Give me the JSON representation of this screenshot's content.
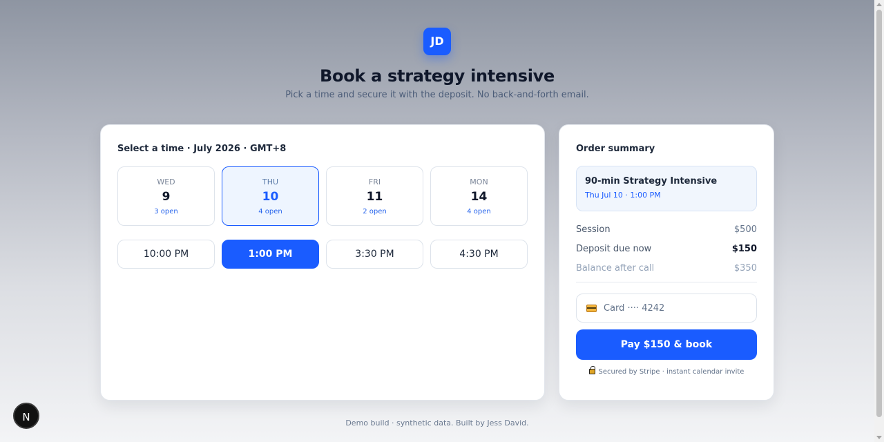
{
  "header": {
    "avatar_initials": "JD",
    "title": "Book a strategy intensive",
    "subtitle": "Pick a time and secure it with the deposit. No back-and-forth email."
  },
  "scheduler": {
    "title": "Select a time · July 2026 · GMT+8",
    "days": [
      {
        "dow": "WED",
        "num": "9",
        "open": "3 open",
        "selected": false
      },
      {
        "dow": "THU",
        "num": "10",
        "open": "4 open",
        "selected": true
      },
      {
        "dow": "FRI",
        "num": "11",
        "open": "2 open",
        "selected": false
      },
      {
        "dow": "MON",
        "num": "14",
        "open": "4 open",
        "selected": false
      }
    ],
    "slots": [
      {
        "label": "10:00 PM",
        "selected": false
      },
      {
        "label": "1:00 PM",
        "selected": true
      },
      {
        "label": "3:30 PM",
        "selected": false
      },
      {
        "label": "4:30 PM",
        "selected": false
      }
    ]
  },
  "summary": {
    "title": "Order summary",
    "service_name": "90-min Strategy Intensive",
    "service_when": "Thu Jul 10 · 1:00 PM",
    "lines": [
      {
        "label": "Session",
        "amount": "$500"
      },
      {
        "label": "Deposit due now",
        "amount": "$150"
      },
      {
        "label": "Balance after call",
        "amount": "$350"
      }
    ],
    "card_label": "Card ···· 4242",
    "pay_label": "Pay $150 & book",
    "secure_note": "Secured by Stripe · instant calendar invite"
  },
  "footer": {
    "text": "Demo build · synthetic data. Built by Jess David."
  },
  "dev_badge": "N",
  "colors": {
    "accent": "#1a5cff",
    "selected_day_bg": "#eef5ff"
  }
}
